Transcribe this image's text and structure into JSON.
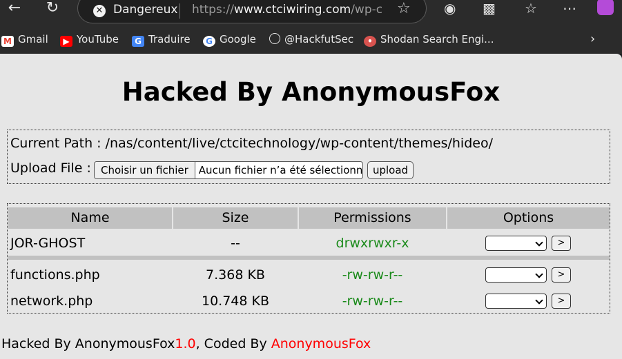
{
  "browser": {
    "security_label": "Dangereux",
    "url_scheme": "https://",
    "url_host": "www.ctciwiring.com",
    "url_path": "/wp-c...",
    "bookmarks": [
      {
        "label": "Gmail"
      },
      {
        "label": "YouTube"
      },
      {
        "label": "Traduire"
      },
      {
        "label": "Google"
      },
      {
        "label": "@HackfutSec"
      },
      {
        "label": "Shodan Search Engi..."
      }
    ]
  },
  "page": {
    "title": "Hacked By AnonymousFox",
    "path_label": "Current Path :",
    "path_value": "/nas/content/live/ctcitechnology/wp-content/themes/hideo/",
    "upload_label": "Upload File :",
    "file_button": "Choisir un fichier",
    "file_status": "Aucun fichier n’a été sélectionné",
    "upload_button": "upload",
    "columns": [
      "Name",
      "Size",
      "Permissions",
      "Options"
    ],
    "rows": [
      {
        "name": "JOR-GHOST",
        "size": "--",
        "perms": "drwxrwxr-x"
      },
      {
        "name": "functions.php",
        "size": "7.368 KB",
        "perms": "-rw-rw-r--"
      },
      {
        "name": "network.php",
        "size": "10.748 KB",
        "perms": "-rw-rw-r--"
      }
    ],
    "go_label": ">",
    "footer": {
      "part1": "Hacked By AnonymousFox",
      "version": "1.0",
      "part2": ", Coded By ",
      "author": "AnonymousFox"
    }
  },
  "colors": {
    "permissions": "#1a8a1a",
    "footer_highlight": "#ff0000"
  }
}
